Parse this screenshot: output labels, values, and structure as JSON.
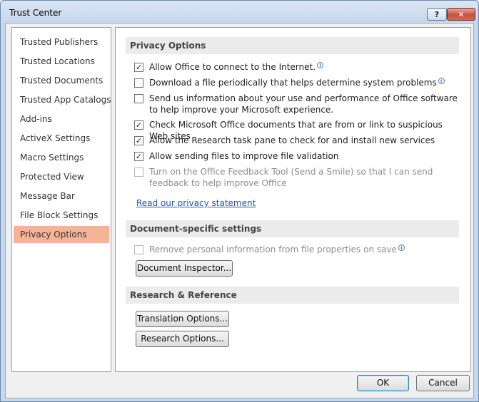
{
  "window": {
    "title": "Trust Center",
    "help_label": "?",
    "close_label": "✕"
  },
  "nav": {
    "items": [
      {
        "label": "Trusted Publishers"
      },
      {
        "label": "Trusted Locations"
      },
      {
        "label": "Trusted Documents"
      },
      {
        "label": "Trusted App Catalogs"
      },
      {
        "label": "Add-ins"
      },
      {
        "label": "ActiveX Settings"
      },
      {
        "label": "Macro Settings"
      },
      {
        "label": "Protected View"
      },
      {
        "label": "Message Bar"
      },
      {
        "label": "File Block Settings"
      },
      {
        "label": "Privacy Options"
      }
    ],
    "selected": "Privacy Options"
  },
  "privacy": {
    "heading": "Privacy Options",
    "options": [
      {
        "label": "Allow Office to connect to the Internet.",
        "checked": true,
        "mark": "✓"
      },
      {
        "label": "Download a file periodically that helps determine system problems",
        "checked": false,
        "mark": ""
      },
      {
        "label": "Send us information about your use and performance of Office software to help improve your Microsoft experience.",
        "checked": false,
        "mark": ""
      },
      {
        "label": "Check Microsoft Office documents that are from or link to suspicious Web sites",
        "checked": true,
        "mark": "✓"
      },
      {
        "label": "Allow the Research task pane to check for and install new services",
        "checked": true,
        "mark": "✓"
      },
      {
        "label": "Allow sending files to improve file validation",
        "checked": true,
        "mark": "✓"
      },
      {
        "label": "Turn on the Office Feedback Tool (Send a Smile) so that I can send feedback to help improve Office",
        "checked": false,
        "disabled": true,
        "mark": ""
      }
    ],
    "privacy_link": "Read our privacy statement"
  },
  "document": {
    "heading": "Document-specific settings",
    "remove_info": {
      "label": "Remove personal information from file properties on save",
      "checked": false,
      "disabled": true,
      "mark": ""
    },
    "inspector_button": "Document Inspector..."
  },
  "research": {
    "heading": "Research & Reference",
    "translation_button": "Translation Options...",
    "research_button": "Research Options..."
  },
  "footer": {
    "ok_label": "OK",
    "cancel_label": "Cancel"
  },
  "icons": {
    "info": "info-icon",
    "help": "help-icon",
    "close": "close-icon"
  },
  "colors": {
    "selected_nav": "#f6b497",
    "link": "#1f5aa8",
    "section_header_bg": "#ebebeb"
  }
}
